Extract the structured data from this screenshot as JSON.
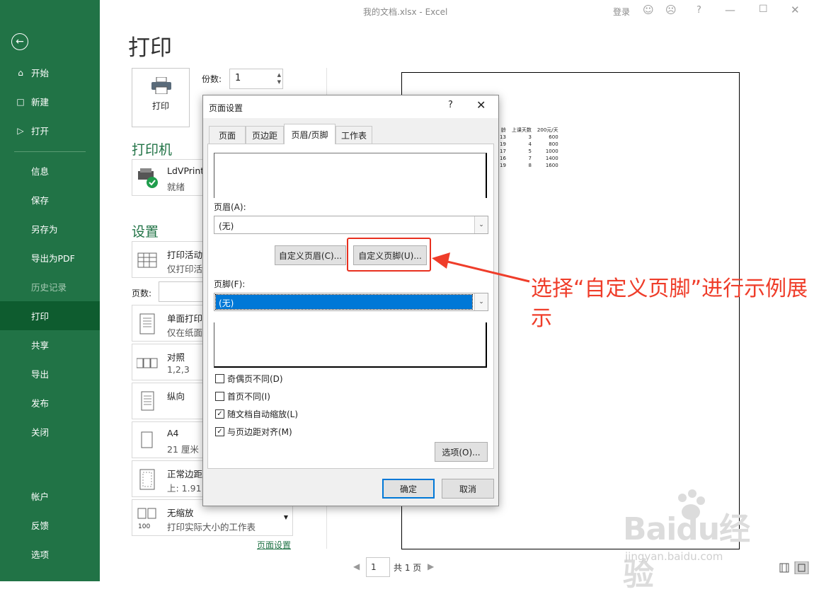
{
  "window": {
    "title": "我的文档.xlsx  -  Excel",
    "login": "登录",
    "help": "?"
  },
  "sidebar": {
    "items": [
      {
        "label": "开始",
        "icon": "home-icon"
      },
      {
        "label": "新建",
        "icon": "new-document-icon"
      },
      {
        "label": "打开",
        "icon": "open-folder-icon"
      },
      {
        "label": "信息"
      },
      {
        "label": "保存"
      },
      {
        "label": "另存为"
      },
      {
        "label": "导出为PDF"
      },
      {
        "label": "历史记录"
      },
      {
        "label": "打印"
      },
      {
        "label": "共享"
      },
      {
        "label": "导出"
      },
      {
        "label": "发布"
      },
      {
        "label": "关闭"
      },
      {
        "label": "帐户"
      },
      {
        "label": "反馈"
      },
      {
        "label": "选项"
      }
    ]
  },
  "print": {
    "title": "打印",
    "print_button": "打印",
    "copies_label": "份数:",
    "copies_value": "1",
    "printer_heading": "打印机",
    "printer_name": "LdVPrint",
    "printer_status": "就绪",
    "settings_heading": "设置",
    "settings": [
      {
        "line1": "打印活动",
        "line2": "仅打印活"
      },
      {
        "line1": "单面打印",
        "line2": "仅在纸面"
      },
      {
        "line1": "对照",
        "line2": "1,2,3"
      },
      {
        "line1": "纵向",
        "line2": ""
      },
      {
        "line1": "A4",
        "line2": "21 厘米"
      },
      {
        "line1": "正常边距",
        "line2": "上: 1.91"
      },
      {
        "line1": "无缩放",
        "line2": "打印实际大小的工作表"
      }
    ],
    "pages_label": "页数:",
    "page_setup_link": "页面设置",
    "pager": {
      "current": "1",
      "total": "共 1 页"
    }
  },
  "preview_table": {
    "headers": [
      "龄",
      "上课天数",
      "200元/天"
    ],
    "rows": [
      [
        "13",
        "3",
        "600"
      ],
      [
        "19",
        "4",
        "800"
      ],
      [
        "17",
        "5",
        "1000"
      ],
      [
        "16",
        "7",
        "1400"
      ],
      [
        "19",
        "8",
        "1600"
      ]
    ]
  },
  "dialog": {
    "title": "页面设置",
    "help": "?",
    "tabs": [
      "页面",
      "页边距",
      "页眉/页脚",
      "工作表"
    ],
    "header_label": "页眉(A):",
    "header_value": "(无)",
    "custom_header_button": "自定义页眉(C)...",
    "custom_footer_button": "自定义页脚(U)...",
    "footer_label": "页脚(F):",
    "footer_value": "(无)",
    "checkboxes": [
      {
        "label": "奇偶页不同(D)",
        "checked": false
      },
      {
        "label": "首页不同(I)",
        "checked": false
      },
      {
        "label": "随文档自动缩放(L)",
        "checked": true
      },
      {
        "label": "与页边距对齐(M)",
        "checked": true
      }
    ],
    "options_button": "选项(O)...",
    "ok_button": "确定",
    "cancel_button": "取消"
  },
  "annotation": {
    "text": "选择“自定义页脚”进行示例展示",
    "color": "#ef3d2a"
  },
  "watermark": {
    "brand": "Baidu经验",
    "url": "jingyan.baidu.com"
  },
  "colors": {
    "accent": "#217346",
    "selection": "#0078d7",
    "highlight": "#e8301f"
  }
}
